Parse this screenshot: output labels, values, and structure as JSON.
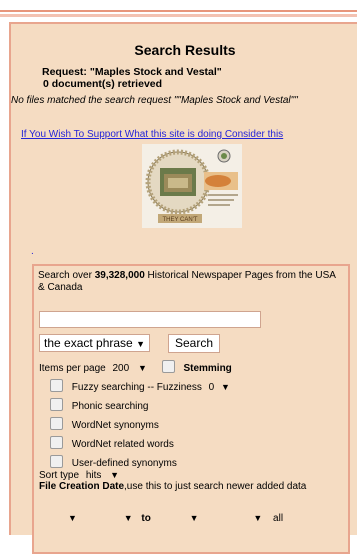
{
  "title": "Search Results",
  "request_line": "Request: \"Maples Stock and Vestal\"",
  "retrieved_line": "0 document(s) retrieved",
  "no_match": "No files matched the search request \"\"Maples Stock and Vestal\"\"",
  "support_link": {
    "part1": "If You Wish To Support What this site is",
    "part2": "doing Consider this"
  },
  "logo_text": "THEY CAN'T",
  "dot": ".",
  "search": {
    "intro_pre": "Search over",
    "intro_count": "39,328,000",
    "intro_post": "Historical Newspaper Pages from the USA & Canada",
    "input_value": "",
    "mode_selected": "the exact phrase",
    "search_button": "Search",
    "items_per_page_label": "Items per page",
    "items_per_page_value": "200",
    "stemming_label": "Stemming",
    "fuzzy_label": "Fuzzy searching -- Fuzziness",
    "fuzzy_value": "0",
    "phonic_label": "Phonic searching",
    "wordnet_syn_label": "WordNet synonyms",
    "wordnet_rel_label": "WordNet related words",
    "user_syn_label": "User-defined synonyms",
    "sort_label": "Sort type",
    "sort_value": "hits",
    "file_date_label": "File Creation Date",
    "file_date_note": ",use this to just search newer added data",
    "to_label": "to",
    "all_label": "all"
  }
}
